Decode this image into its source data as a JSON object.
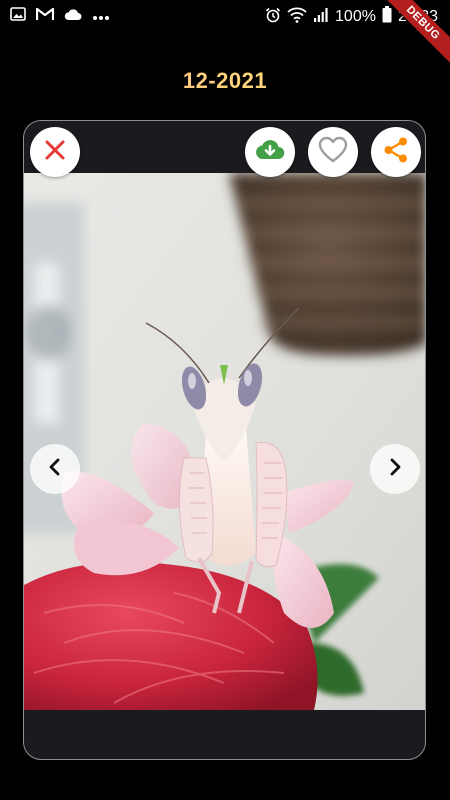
{
  "status_bar": {
    "battery_percent": "100%",
    "time": "23:33",
    "left_icons": [
      "image-icon",
      "gmail-icon",
      "cloud-icon",
      "more-dots-icon"
    ],
    "right_icons": [
      "alarm-icon",
      "wifi-icon",
      "signal-icon",
      "battery-icon"
    ]
  },
  "debug_banner": "DEBUG",
  "viewer": {
    "date_title": "12-2021",
    "photo_subject": "orchid mantis on red flower",
    "actions": {
      "close": "close-icon",
      "download": "cloud-download-icon",
      "favorite": "heart-icon",
      "share": "share-icon"
    },
    "navigation": {
      "previous": "chevron-left-icon",
      "next": "chevron-right-icon"
    }
  },
  "colors": {
    "background": "#000000",
    "card": "#1b1a1f",
    "card_border": "#8f8f8f",
    "close_red": "#e53935",
    "download_green": "#43a047",
    "heart_gray": "#9e9e9e",
    "share_orange": "#fb8c00",
    "debug_red": "#b31e1e",
    "title_gradient": [
      "#ff9a9a",
      "#ffd27a",
      "#fff07a"
    ]
  }
}
